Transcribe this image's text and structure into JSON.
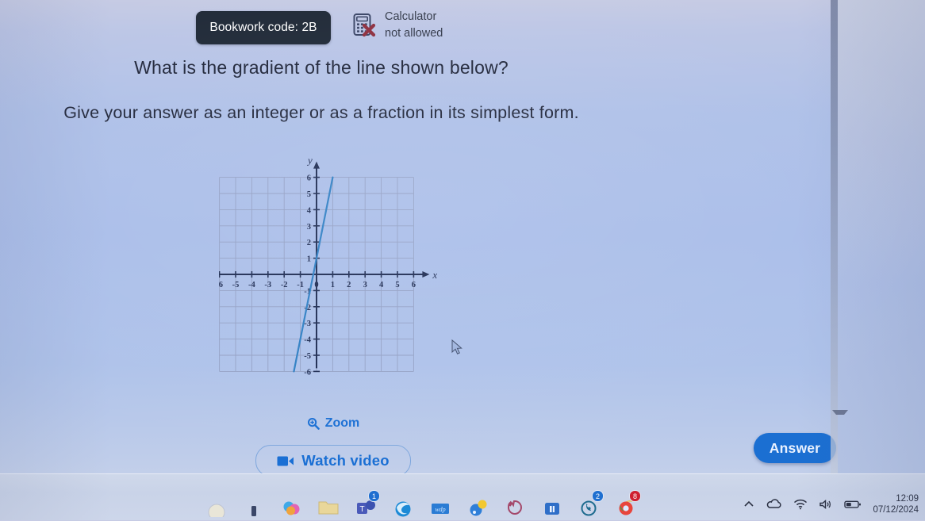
{
  "header": {
    "bookwork_label": "Bookwork code: 2B",
    "calculator_line1": "Calculator",
    "calculator_line2": "not allowed",
    "calculator_icon": "calculator-not-allowed-icon"
  },
  "question": {
    "line1": "What is the gradient of the line shown below?",
    "line2": "Give your answer as an integer or as a fraction in its simplest form."
  },
  "controls": {
    "zoom_label": "Zoom",
    "zoom_icon": "magnifier-plus-icon",
    "watch_video_label": "Watch video",
    "watch_video_icon": "video-camera-icon",
    "answer_label": "Answer"
  },
  "chart_data": {
    "type": "line",
    "title": "",
    "xlabel": "x",
    "ylabel": "y",
    "xlim": [
      -6,
      6
    ],
    "ylim": [
      -6,
      6
    ],
    "xticks": [
      -6,
      -5,
      -4,
      -3,
      -2,
      -1,
      0,
      1,
      2,
      3,
      4,
      5,
      6
    ],
    "yticks": [
      -6,
      -5,
      -4,
      -3,
      -2,
      -1,
      0,
      1,
      2,
      3,
      4,
      5,
      6
    ],
    "xtick_labels": [
      "-6",
      "-5",
      "-4",
      "-3",
      "-2",
      "-1",
      "0",
      "1",
      "2",
      "3",
      "4",
      "5",
      "6"
    ],
    "ytick_labels": [
      "-6",
      "-5",
      "-4",
      "-3",
      "-2",
      "-1",
      "",
      "1",
      "2",
      "3",
      "4",
      "5",
      "6"
    ],
    "grid": true,
    "grid_color": "#8f9bbe",
    "axis_color": "#1d2b52",
    "line_color": "#2f7fc4",
    "series": [
      {
        "name": "line",
        "equation": "y = 5x + 1",
        "gradient": 5,
        "y_intercept": 1,
        "points": [
          [
            -1.4,
            -6
          ],
          [
            0,
            1
          ],
          [
            1,
            6
          ]
        ]
      }
    ]
  },
  "taskbar": {
    "clock_time": "12:09",
    "clock_date": "07/12/2024",
    "tray_icons": [
      "chevron-up-icon",
      "cloud-icon",
      "wifi-icon",
      "speaker-icon",
      "battery-icon"
    ],
    "app_icons": [
      "start-icon",
      "search-icon",
      "photos-icon",
      "file-explorer-icon",
      "teams-icon",
      "edge-icon",
      "notepad-icon",
      "paint-icon",
      "firefox-icon",
      "office-icon",
      "whatsapp-icon",
      "chrome-icon"
    ],
    "teams_badge": "1",
    "whatsapp_badge": "2",
    "chrome_badge": "8"
  },
  "colors": {
    "accent_blue": "#1b6fd2",
    "dark_chip": "#1f2937",
    "line_blue": "#2f7fc4",
    "page_bg": "#a9bde9"
  }
}
